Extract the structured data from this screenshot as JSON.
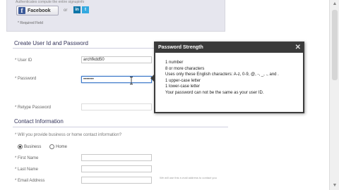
{
  "header": {
    "note": "Authenticates compute the entire signupinfo",
    "facebook_label": "Facebook",
    "or_text": "or",
    "linkedin_label": "in",
    "twitter_label": "t",
    "required_note": "* Required Field"
  },
  "create_section": {
    "title": "Create User Id and Password",
    "user_id_label": "* User ID",
    "user_id_value": "archfkdd50",
    "password_label": "* Password",
    "password_value": "•••••••",
    "retype_label": "* Retype Password",
    "retype_value": ""
  },
  "contact_section": {
    "title": "Contact Information",
    "question": "* Will you provide business or home contact information?",
    "radio_business": "Business",
    "radio_home": "Home",
    "first_name_label": "* First Name",
    "last_name_label": "* Last Name",
    "email_label": "* Email Address",
    "email_note": "We will use this e-mail address to contact you"
  },
  "tooltip": {
    "title": "Password Strength",
    "close": "✕",
    "lines": [
      "1 number",
      "8 or more characters",
      "Uses only these English characters: A-z, 0-9, @, -, _, ., and .",
      "1 upper-case letter",
      "1 lower-case letter",
      "Your password can not be the same as your user ID."
    ]
  },
  "icons": {
    "facebook": "facebook-icon",
    "linkedin": "linkedin-icon",
    "twitter": "twitter-icon",
    "close": "close-icon",
    "cursor": "text-cursor-icon"
  },
  "colors": {
    "facebook_blue": "#3b5998",
    "linkedin_blue": "#0e76a8",
    "twitter_blue": "#33a9e0",
    "tooltip_header": "#3a3a3a",
    "focus_border": "#3a77c8",
    "section_title": "#33335a"
  }
}
